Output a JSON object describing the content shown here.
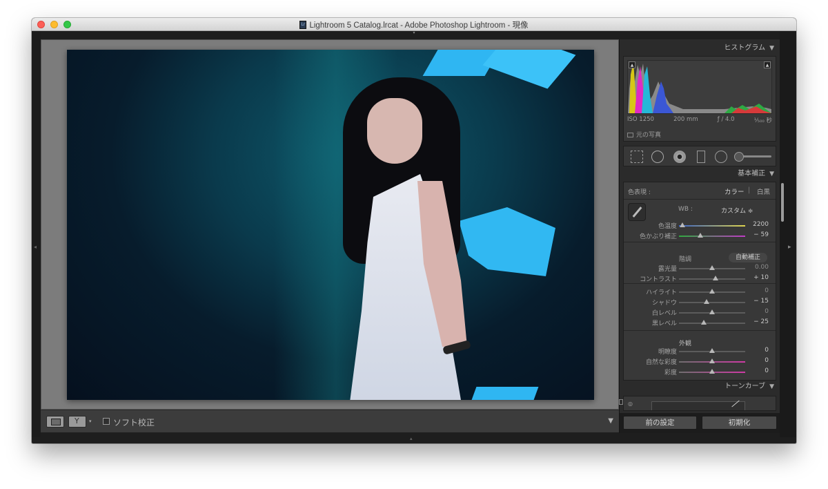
{
  "window": {
    "title": "Lightroom 5 Catalog.lrcat - Adobe Photoshop Lightroom - 現像"
  },
  "toolbar": {
    "soft_proof_label": "ソフト校正"
  },
  "histogram": {
    "header": "ヒストグラム",
    "iso": "ISO 1250",
    "focal": "200 mm",
    "aperture": "ƒ / 4.0",
    "shutter": "¹⁄₅₀₀ 秒",
    "original_photo_label": "元の写真"
  },
  "basic": {
    "header": "基本補正",
    "treatment_label": "色表現 :",
    "treatment_color": "カラー",
    "treatment_bw": "白黒",
    "wb_label": "WB :",
    "wb_value": "カスタム ≑",
    "sliders_wb": [
      {
        "label": "色温度",
        "value": "2200",
        "position": 0.05,
        "kind": "temp"
      },
      {
        "label": "色かぶり補正",
        "value": "− 59",
        "position": 0.32,
        "kind": "tint"
      }
    ],
    "tone_label": "階調",
    "auto_label": "自動補正",
    "sliders_tone": [
      {
        "label": "露光量",
        "value": "0.00",
        "position": 0.5,
        "dim": true
      },
      {
        "label": "コントラスト",
        "value": "+ 10",
        "position": 0.55,
        "dim": false
      }
    ],
    "sliders_tone2": [
      {
        "label": "ハイライト",
        "value": "0",
        "position": 0.5,
        "dim": true
      },
      {
        "label": "シャドウ",
        "value": "− 15",
        "position": 0.42,
        "dim": false
      },
      {
        "label": "白レベル",
        "value": "0",
        "position": 0.5,
        "dim": true
      },
      {
        "label": "黒レベル",
        "value": "− 25",
        "position": 0.38,
        "dim": false
      }
    ],
    "presence_label": "外観",
    "sliders_presence": [
      {
        "label": "明瞭度",
        "value": "0",
        "position": 0.5,
        "kind": "plain"
      },
      {
        "label": "自然な彩度",
        "value": "0",
        "position": 0.5,
        "kind": "vib"
      },
      {
        "label": "彩度",
        "value": "0",
        "position": 0.5,
        "kind": "sat"
      }
    ]
  },
  "tone_curve": {
    "header": "トーンカーブ"
  },
  "footer": {
    "previous_label": "前の設定",
    "reset_label": "初期化"
  },
  "colors": {
    "accent_photo_bg": "#0a3a4c",
    "panel_bg": "#383838"
  }
}
